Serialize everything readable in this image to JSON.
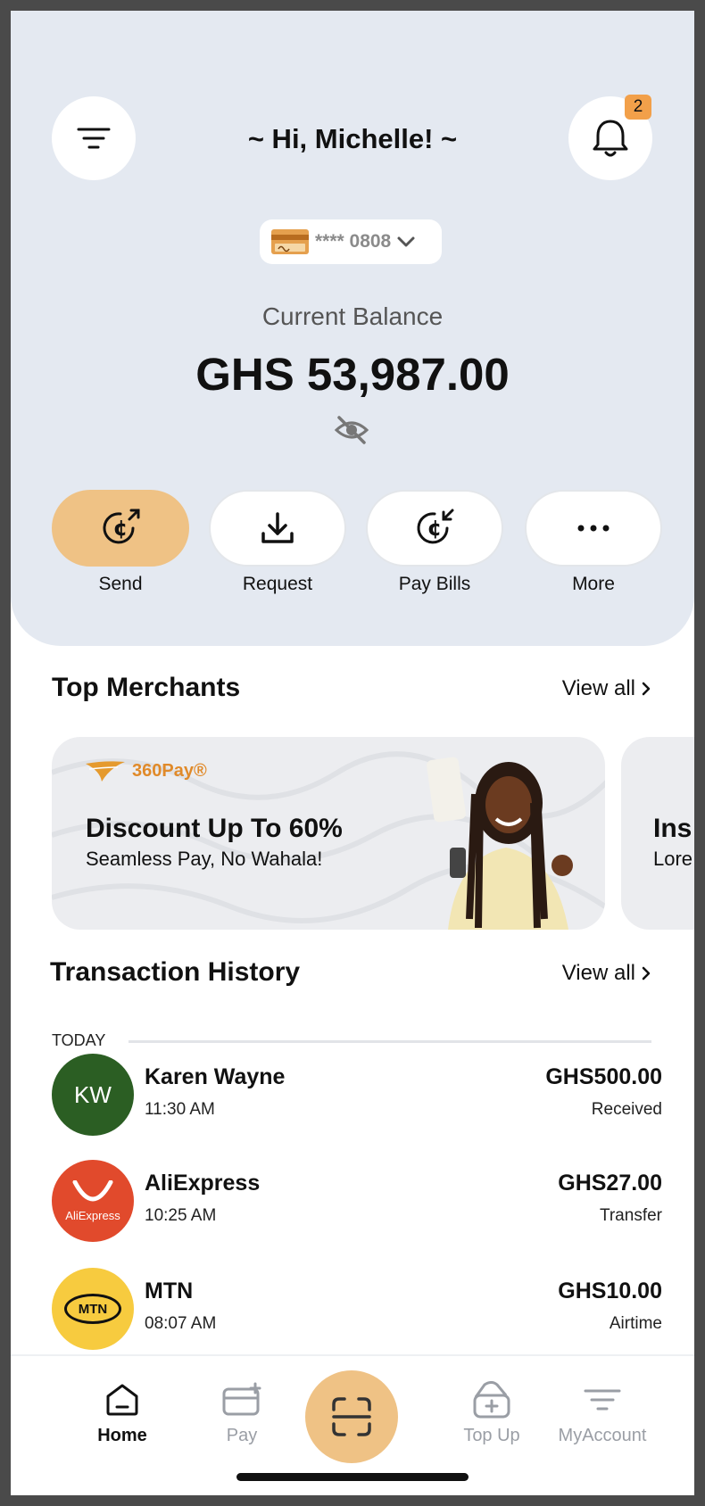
{
  "header": {
    "greeting": "~ Hi, Michelle! ~",
    "notification_count": "2"
  },
  "account": {
    "card_masked": "**** 0808",
    "balance_label": "Current Balance",
    "balance_amount": "GHS 53,987.00"
  },
  "actions": [
    {
      "label": "Send",
      "icon": "send-cedi-icon"
    },
    {
      "label": "Request",
      "icon": "download-icon"
    },
    {
      "label": "Pay Bills",
      "icon": "receive-cedi-icon"
    },
    {
      "label": "More",
      "icon": "more-dots-icon"
    }
  ],
  "merchants": {
    "title": "Top Merchants",
    "view_all": "View all",
    "banners": [
      {
        "brand": "360Pay®",
        "title": "Discount Up To 60%",
        "subtitle": "Seamless Pay, No Wahala!"
      },
      {
        "title": "Ins",
        "subtitle": "Lore"
      }
    ]
  },
  "transactions": {
    "title": "Transaction History",
    "view_all": "View all",
    "group_label": "TODAY",
    "items": [
      {
        "initials": "KW",
        "name": "Karen Wayne",
        "time": "11:30 AM",
        "amount": "GHS500.00",
        "status": "Received",
        "avatar_color": "#2b5e23"
      },
      {
        "logo_text": "AliExpress",
        "name": "AliExpress",
        "time": "10:25 AM",
        "amount": "GHS27.00",
        "status": "Transfer",
        "avatar_color": "#e14a2c"
      },
      {
        "logo_text": "MTN",
        "name": "MTN",
        "time": "08:07 AM",
        "amount": "GHS10.00",
        "status": "Airtime",
        "avatar_color": "#f7cb3f"
      }
    ]
  },
  "tabbar": {
    "tabs": [
      {
        "label": "Home",
        "active": true
      },
      {
        "label": "Pay"
      },
      {
        "label": "Top Up"
      },
      {
        "label": "MyAccount"
      }
    ]
  },
  "colors": {
    "accent": "#efc285",
    "hero_bg": "#e4e9f1",
    "badge": "#f2a04a"
  }
}
